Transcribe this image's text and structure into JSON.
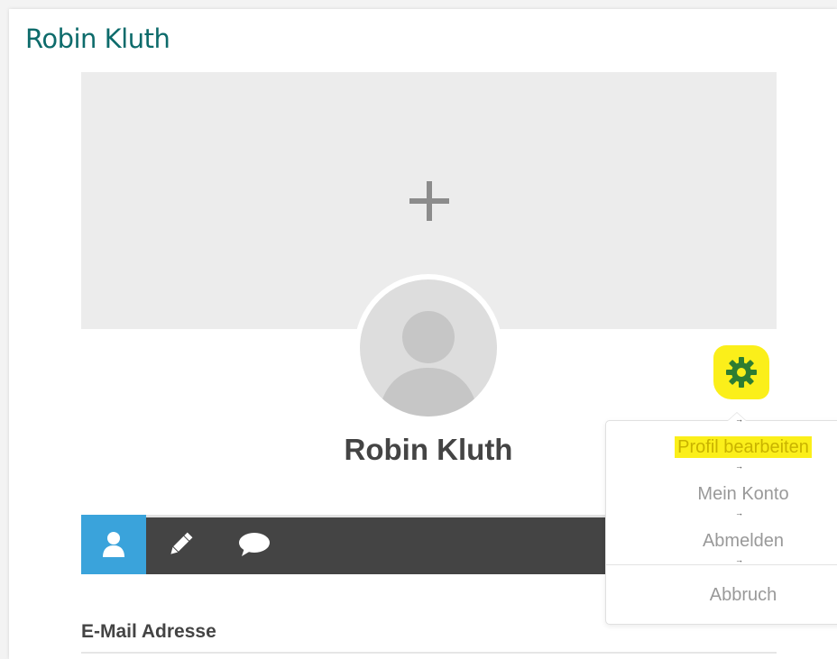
{
  "page": {
    "title": "Robin Kluth"
  },
  "cover": {
    "add_icon": "plus-icon"
  },
  "profile": {
    "name": "Robin Kluth",
    "avatar_icon": "user-silhouette-icon"
  },
  "settings": {
    "icon": "gear-icon",
    "highlight_color": "#fbef1a",
    "icon_color": "#2e7d32"
  },
  "toolbar": {
    "tabs": [
      {
        "icon": "user-icon",
        "active": true
      },
      {
        "icon": "pencil-icon",
        "active": false
      },
      {
        "icon": "speech-bubble-icon",
        "active": false
      }
    ],
    "active_color": "#3aa3db",
    "bar_color": "#444444"
  },
  "fields": {
    "email_label": "E-Mail Adresse"
  },
  "dropdown": {
    "arrow_glyph": "→",
    "items": [
      {
        "label": "Profil bearbeiten",
        "highlighted": true
      },
      {
        "label": "Mein Konto",
        "highlighted": false
      },
      {
        "label": "Abmelden",
        "highlighted": false
      }
    ],
    "cancel_label": "Abbruch"
  }
}
